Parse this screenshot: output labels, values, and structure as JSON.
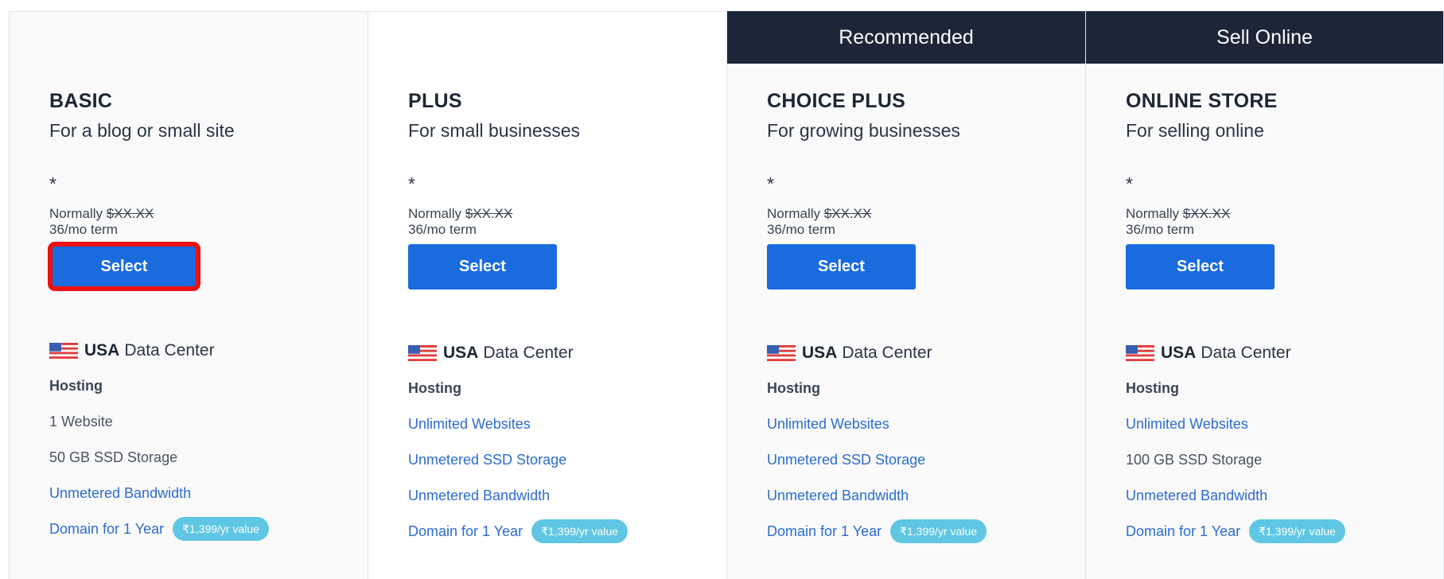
{
  "plans": [
    {
      "banner": "",
      "name": "BASIC",
      "tagline": "For a blog or small site",
      "asterisk": "*",
      "normally_label": "Normally",
      "normally_price": "$XX.XX",
      "term": "36/mo term",
      "select_label": "Select",
      "datacenter_bold": "USA",
      "datacenter_rest": "Data Center",
      "hosting_heading": "Hosting",
      "features": [
        "1 Website",
        "50 GB SSD Storage",
        "Unmetered Bandwidth",
        "Domain for 1 Year"
      ],
      "domain_badge": "₹1,399/yr value"
    },
    {
      "banner": "",
      "name": "PLUS",
      "tagline": "For small businesses",
      "asterisk": "*",
      "normally_label": "Normally",
      "normally_price": "$XX.XX",
      "term": "36/mo term",
      "select_label": "Select",
      "datacenter_bold": "USA",
      "datacenter_rest": "Data Center",
      "hosting_heading": "Hosting",
      "features": [
        "Unlimited Websites",
        "Unmetered SSD Storage",
        "Unmetered Bandwidth",
        "Domain for 1 Year"
      ],
      "domain_badge": "₹1,399/yr value"
    },
    {
      "banner": "Recommended",
      "name": "CHOICE PLUS",
      "tagline": "For growing businesses",
      "asterisk": "*",
      "normally_label": "Normally",
      "normally_price": "$XX.XX",
      "term": "36/mo term",
      "select_label": "Select",
      "datacenter_bold": "USA",
      "datacenter_rest": "Data Center",
      "hosting_heading": "Hosting",
      "features": [
        "Unlimited Websites",
        "Unmetered SSD Storage",
        "Unmetered Bandwidth",
        "Domain for 1 Year"
      ],
      "domain_badge": "₹1,399/yr value"
    },
    {
      "banner": "Sell Online",
      "name": "ONLINE STORE",
      "tagline": "For selling online",
      "asterisk": "*",
      "normally_label": "Normally",
      "normally_price": "$XX.XX",
      "term": "36/mo term",
      "select_label": "Select",
      "datacenter_bold": "USA",
      "datacenter_rest": "Data Center",
      "hosting_heading": "Hosting",
      "features": [
        "Unlimited Websites",
        "100 GB SSD Storage",
        "Unmetered Bandwidth",
        "Domain for 1 Year"
      ],
      "domain_badge": "₹1,399/yr value"
    }
  ],
  "colors": {
    "banner_bg": "#1c2638",
    "select_button": "#196bde",
    "link_text": "#2c6cd0",
    "badge_bg": "#5fc7e3",
    "highlight_outline": "#ee1111"
  },
  "icons": {
    "datacenter_flag": "usa-flag-icon"
  }
}
